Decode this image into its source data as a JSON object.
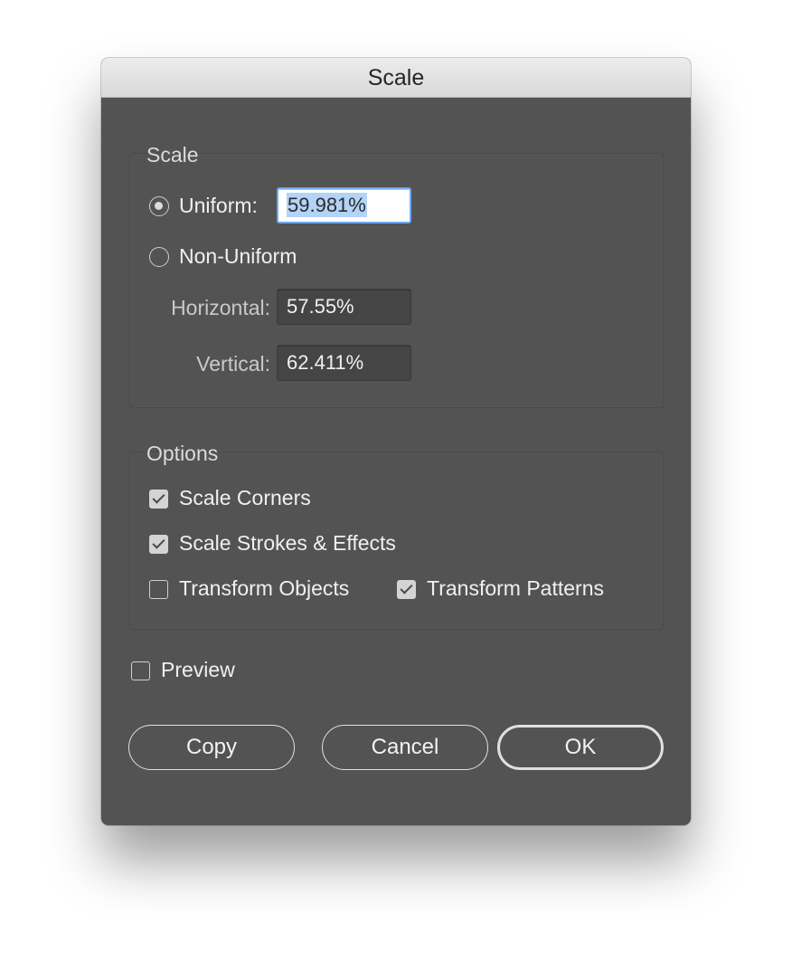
{
  "window": {
    "title": "Scale"
  },
  "scale_group": {
    "title": "Scale",
    "uniform": {
      "label": "Uniform:",
      "value": "59.981%",
      "selected": true
    },
    "non_uniform": {
      "label": "Non-Uniform",
      "selected": false
    },
    "horizontal": {
      "label": "Horizontal:",
      "value": "57.55%"
    },
    "vertical": {
      "label": "Vertical:",
      "value": "62.411%"
    }
  },
  "options_group": {
    "title": "Options",
    "scale_corners": {
      "label": "Scale Corners",
      "checked": true
    },
    "scale_strokes": {
      "label": "Scale Strokes & Effects",
      "checked": true
    },
    "transform_objects": {
      "label": "Transform Objects",
      "checked": false
    },
    "transform_patterns": {
      "label": "Transform Patterns",
      "checked": true
    }
  },
  "preview": {
    "label": "Preview",
    "checked": false
  },
  "buttons": {
    "copy": "Copy",
    "cancel": "Cancel",
    "ok": "OK"
  },
  "colors": {
    "panel": "#535353",
    "focus": "#6fa8ee",
    "selection": "#b3d3f7"
  }
}
